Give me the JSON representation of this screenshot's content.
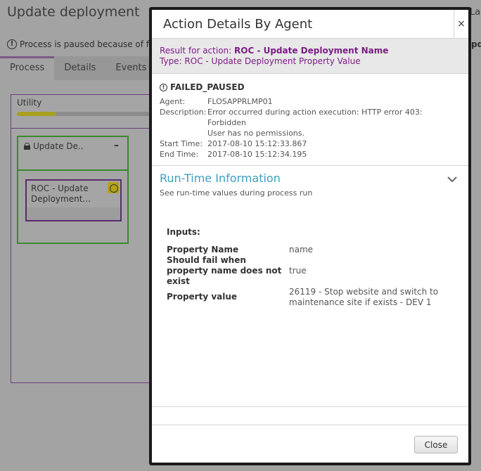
{
  "background": {
    "page_title": "Update deployment",
    "page_title_right_fragment": "La",
    "paused_message": "Process is paused because of fa",
    "right_fragment": "pd",
    "tabs": [
      {
        "label": "Process",
        "active": true
      },
      {
        "label": "Details",
        "active": false
      },
      {
        "label": "Events",
        "active": false
      }
    ],
    "utility_label": "Utility",
    "group_title": "Update De..",
    "group_collapse": "–",
    "step_label": "ROC - Update Deployment..."
  },
  "modal": {
    "title": "Action Details By Agent",
    "close_x": "×",
    "result_prefix": "Result for action:",
    "result_action": "ROC - Update Deployment Name",
    "result_type": "Type: ROC - Update Deployment Property Value",
    "status": "FAILED_PAUSED",
    "details": {
      "agent_label": "Agent:",
      "agent_value": "FLOSAPPRLMP01",
      "description_label": "Description:",
      "description_line1": "Error occurred during action execution: HTTP error 403:",
      "description_line2": "Forbidden",
      "description_line3": "User has no permissions.",
      "start_label": "Start Time:",
      "start_value": "2017-08-10 15:12:33.867",
      "end_label": "End Time:",
      "end_value": "2017-08-10 15:12:34.195"
    },
    "runtime": {
      "title": "Run-Time Information",
      "subtitle": "See run-time values during process run",
      "inputs_label": "Inputs:",
      "inputs": [
        {
          "key": "Property Name",
          "value": "name"
        },
        {
          "key": "Should fail when property name does not exist",
          "value": "true"
        },
        {
          "key": "Property value",
          "value": "26119 - Stop website and switch to maintenance site if exists - DEV 1"
        }
      ]
    },
    "close_button": "Close"
  },
  "colors": {
    "accent_purple": "#7b1e86",
    "runtime_blue": "#3ba0c0",
    "group_green": "#3b8a2e",
    "progress_yellow": "#a8a020"
  },
  "icons": [
    "info-icon",
    "close-icon",
    "chevron-down-icon",
    "lock-icon",
    "pause-icon"
  ]
}
